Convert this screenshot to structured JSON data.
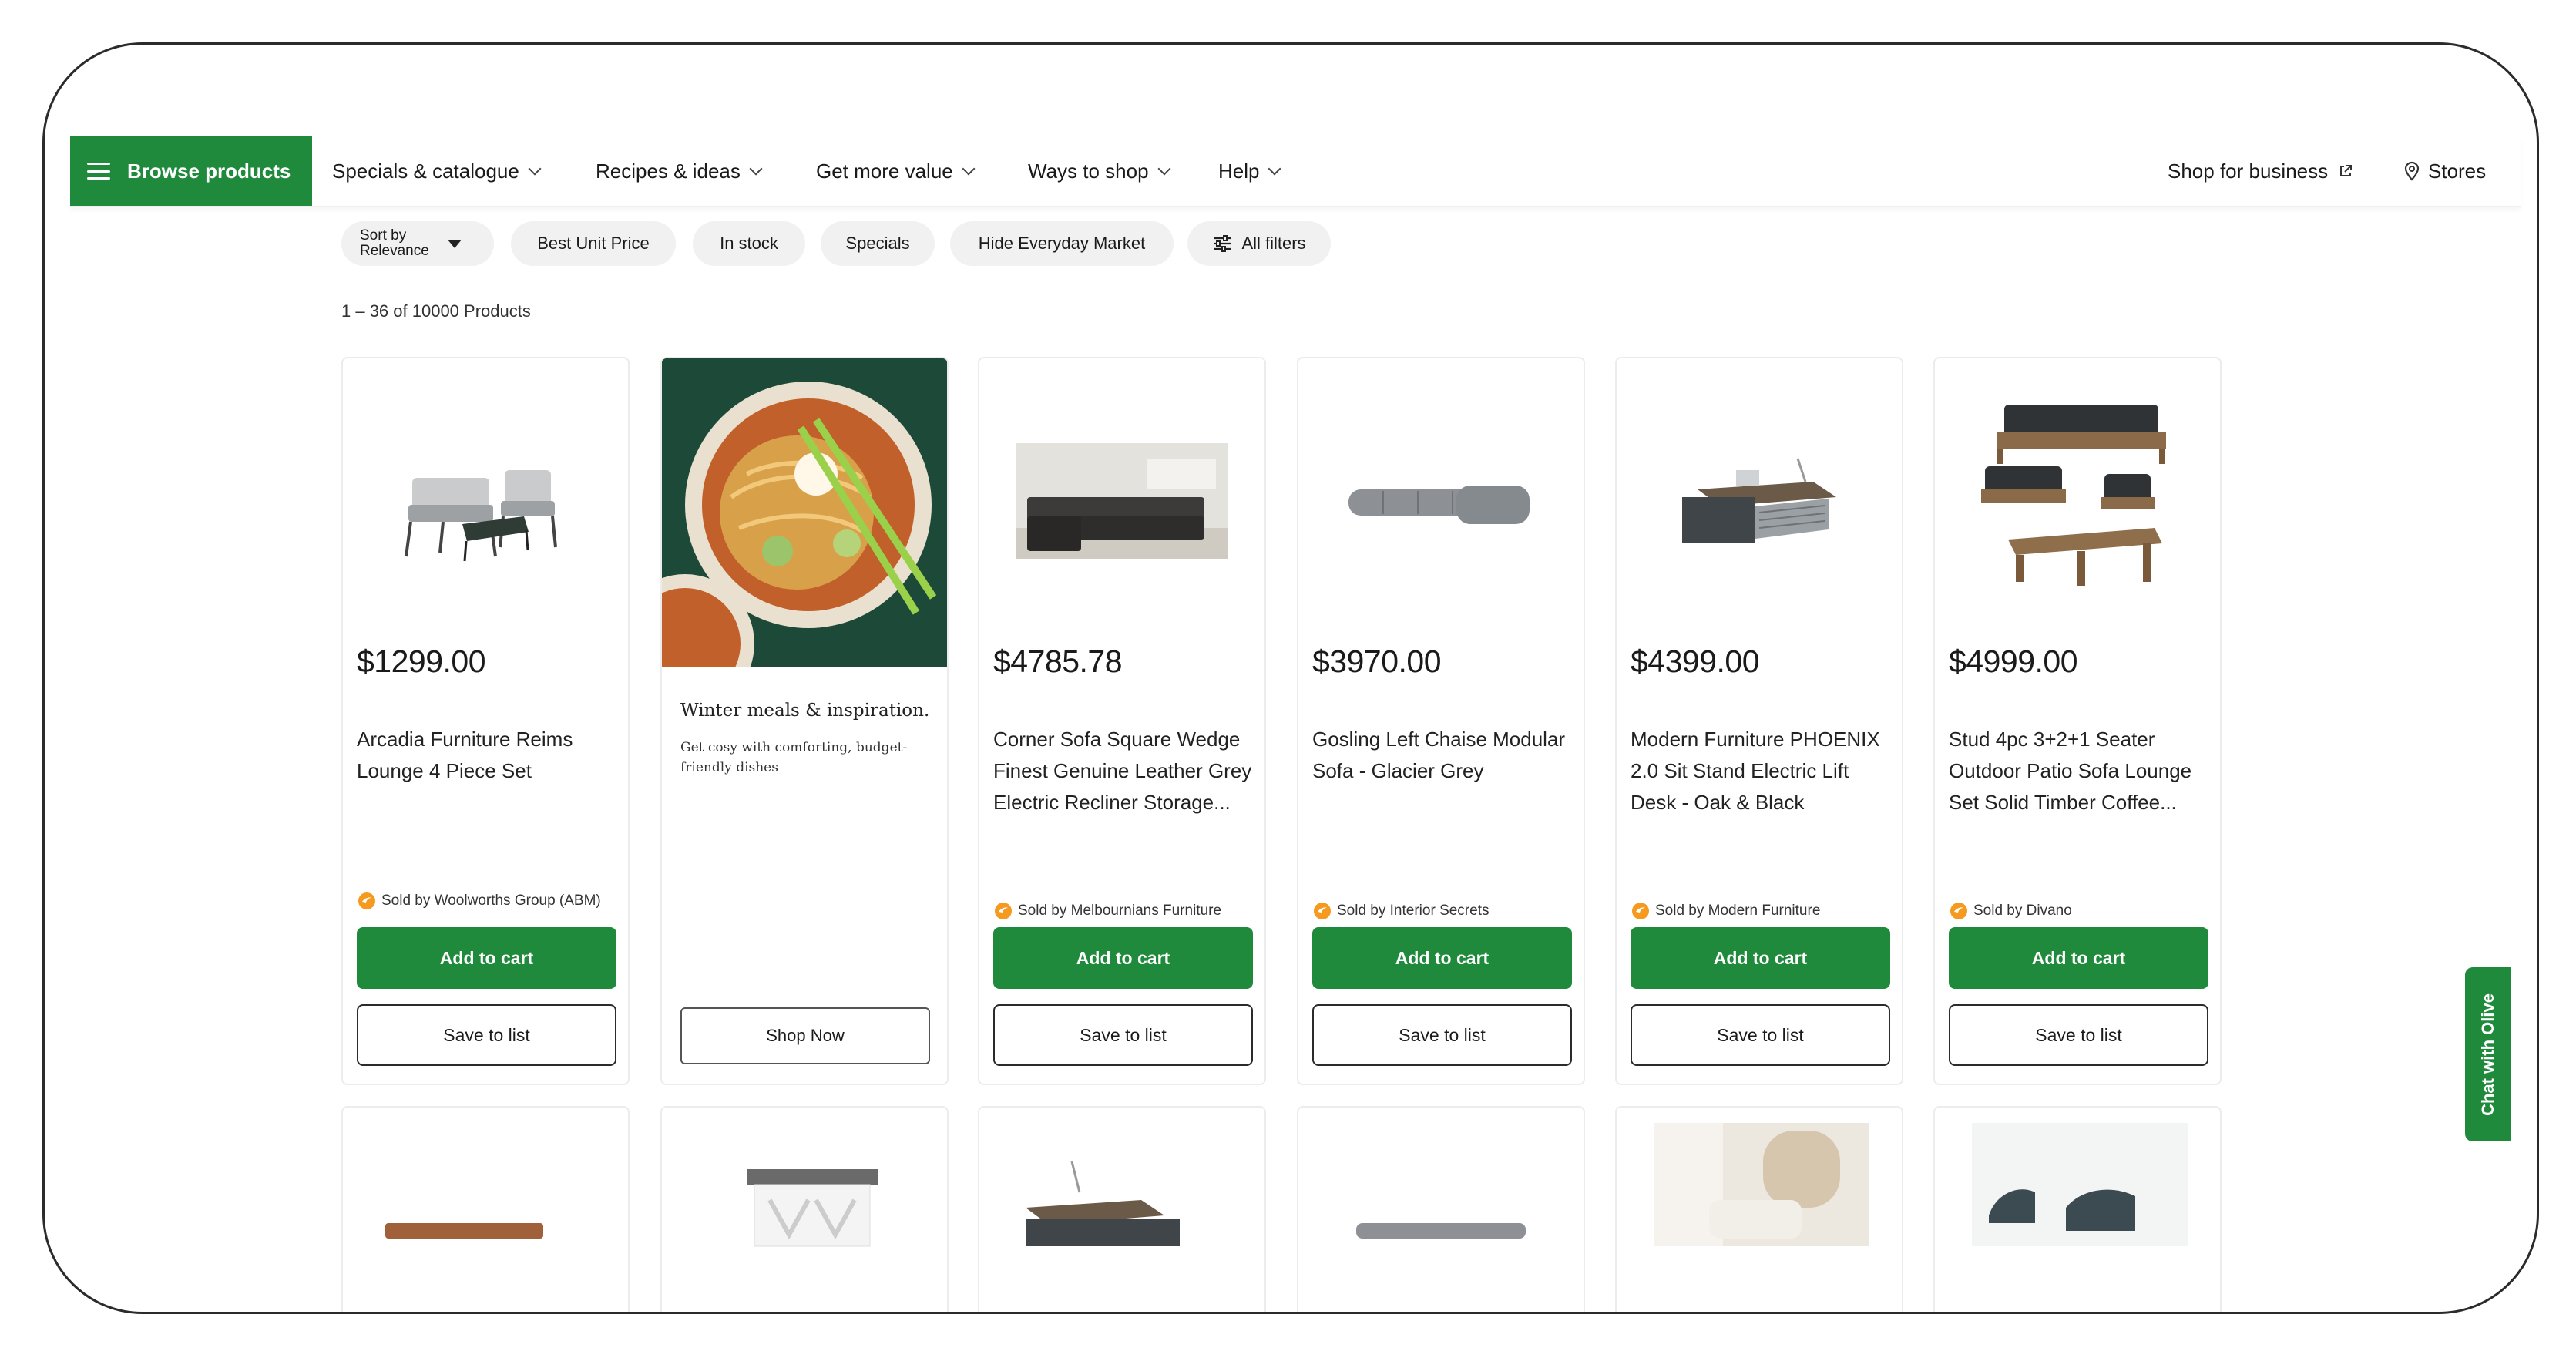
{
  "nav": {
    "browse_label": "Browse products",
    "items": [
      {
        "label": "Specials & catalogue"
      },
      {
        "label": "Recipes & ideas"
      },
      {
        "label": "Get more value"
      },
      {
        "label": "Ways to shop"
      },
      {
        "label": "Help"
      }
    ],
    "shop_for_business": "Shop for business",
    "stores": "Stores"
  },
  "filters": {
    "sort_label": "Sort by",
    "sort_value": "Relevance",
    "pills": [
      "Best Unit Price",
      "In stock",
      "Specials",
      "Hide Everyday Market"
    ],
    "all_filters": "All filters"
  },
  "results_text": "1 – 36 of 10000 Products",
  "products": [
    {
      "price": "$1299.00",
      "name": "Arcadia Furniture Reims Lounge 4 Piece Set",
      "seller": "Sold by Woolworths Group (ABM)",
      "cart": "Add to cart",
      "list": "Save to list"
    },
    {
      "price": "$4785.78",
      "name": "Corner Sofa Square Wedge Finest Genuine Leather Grey Electric Recliner Storage...",
      "seller": "Sold by Melbournians Furniture",
      "cart": "Add to cart",
      "list": "Save to list"
    },
    {
      "price": "$3970.00",
      "name": "Gosling Left Chaise Modular Sofa - Glacier Grey",
      "seller": "Sold by Interior Secrets",
      "cart": "Add to cart",
      "list": "Save to list"
    },
    {
      "price": "$4399.00",
      "name": "Modern Furniture PHOENIX 2.0 Sit Stand Electric Lift Desk - Oak & Black",
      "seller": "Sold by Modern Furniture",
      "cart": "Add to cart",
      "list": "Save to list"
    },
    {
      "price": "$4999.00",
      "name": "Stud 4pc 3+2+1 Seater Outdoor Patio Sofa Lounge Set Solid Timber Coffee...",
      "seller": "Sold by Divano",
      "cart": "Add to cart",
      "list": "Save to list"
    }
  ],
  "promo": {
    "title": "Winter meals & inspiration.",
    "subtitle": "Get cosy with comforting, budget-friendly dishes",
    "button": "Shop Now"
  },
  "chat_label": "Chat with Olive",
  "colors": {
    "brand_green": "#1f8a3b",
    "pill_bg": "#f1f1f1",
    "card_border": "#ececec"
  }
}
